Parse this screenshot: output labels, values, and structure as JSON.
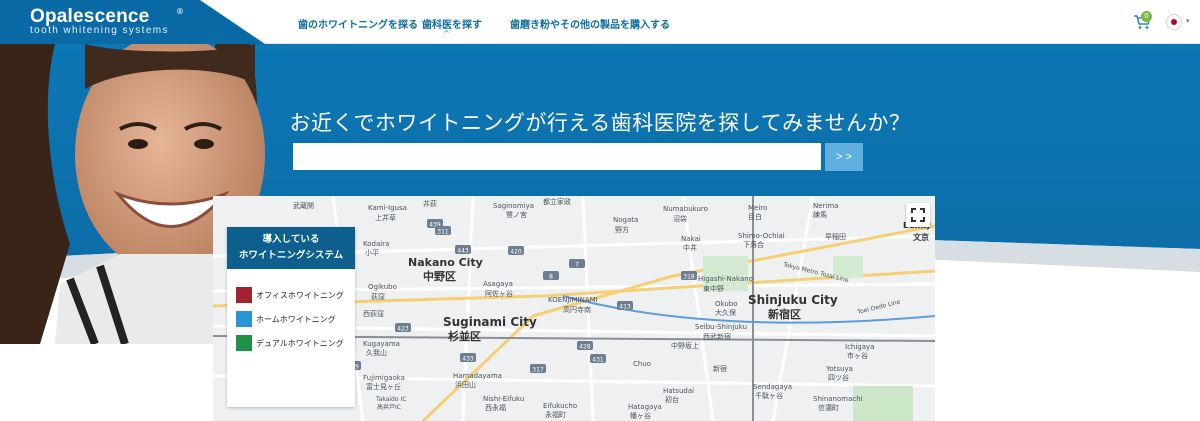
{
  "header": {
    "logo_text": "Opalescence",
    "logo_mark": "®",
    "logo_sub": "tooth whitening systems",
    "nav": [
      {
        "label": "歯のホワイトニングを探る"
      },
      {
        "label": "歯科医を探す",
        "caret": "^"
      },
      {
        "label": "歯磨き粉やその他の製品を購入する"
      }
    ],
    "cart_count": "0",
    "cart_icon": "cart-icon",
    "flag_icon": "japan-flag-icon",
    "flag_caret": "▾",
    "colors": {
      "brand": "#0a6aa6",
      "nav_text": "#0d6f9e"
    }
  },
  "hero": {
    "title": "お近くでホワイトニングが行える歯科医院を探してみませんか？",
    "search_placeholder": "",
    "search_button": "> >",
    "colors": {
      "banner": "#0b77b4",
      "button": "#5fb0de"
    }
  },
  "map": {
    "fullscreen_icon": "fullscreen-icon",
    "labels": {
      "nakano_en": "Nakano City",
      "nakano_jp": "中野区",
      "suginami_en": "Suginami City",
      "suginami_jp": "杉並区",
      "shinjuku_en": "Shinjuku City",
      "shinjuku_jp": "新宿区",
      "koenjiminami": "KOENJIMINAMI",
      "koenji_jp": "高円寺南",
      "asagaya": "Asagaya",
      "asagaya_jp": "阿佐ヶ谷",
      "ogikubo": "Ogikubo",
      "ogikubo_jp": "荻窪",
      "nogata": "Nogata",
      "nogata_jp": "野方",
      "numabukuro": "Numabukuro",
      "numabukuro_jp": "沼袋",
      "saginomiya": "Saginomiya",
      "saginomiya_jp": "鷺ノ宮",
      "kamiigusa": "Kami-Igusa",
      "kamiigusa_jp": "上井草",
      "musashiseki_jp": "武蔵関",
      "igusa_jp": "井荻",
      "toritsukasei_jp": "都立家政",
      "nakai": "Nakai",
      "nakai_jp": "中井",
      "shimoochiai": "Shimo-Ochiai",
      "shimoochiai_jp": "下落合",
      "higashinakano": "Higashi-Nakano",
      "higashinakano_jp": "東中野",
      "okubo": "Okubo",
      "okubo_jp": "大久保",
      "seibushinjuku": "Seibu-Shinjuku",
      "seibushinjuku_jp": "西武新宿",
      "meiro": "Meiro",
      "meiro_jp": "目白",
      "hamadayama": "Hamadayama",
      "hamadayama_jp": "浜田山",
      "eifukucho": "Eifukucho",
      "eifukucho_jp": "永福町",
      "nishieifuku": "Nishi-Eifuku",
      "nishieifuku_jp": "西永福",
      "fujimigaoka": "Fujimigaoka",
      "fujimigaoka_jp": "富士見ヶ丘",
      "kugayama": "Kugayama",
      "kugayama_jp": "久我山",
      "takaido": "Takaido IC",
      "takaido_jp": "高井戸IC",
      "hatsudai": "Hatsudai",
      "hatsudai_jp": "初台",
      "hatagaya": "Hatagaya",
      "hatagaya_jp": "幡ヶ谷",
      "yotsuya": "Yotsuya",
      "yotsuya_jp": "四ツ谷",
      "ichigaya": "Ichigaya",
      "ichigaya_jp": "市ヶ谷",
      "sendagaya": "Sendagaya",
      "sendagaya_jp": "千駄ヶ谷",
      "shinanomachi": "Shinanomachi",
      "shinanomachi_jp": "信濃町",
      "tokyometro": "Tokyo Metro Tozai Line",
      "toeioedo": "Toei Oedo Line",
      "bunkyo": "Bunky",
      "bunkyo_jp": "文京",
      "waseda_jp": "早稲田",
      "nakanosakaue_jp": "中野坂上",
      "shinjuku_jp2": "新宿",
      "kokubunji": "Kodaira",
      "kodaira_jp": "小平",
      "nishiogi_jp": "西荻窪",
      "bar_a": "Chuo",
      "toritsudaigaku": "Nerima",
      "nerima_jp": "練馬"
    },
    "route_numbers": [
      "439",
      "311",
      "443",
      "420",
      "7",
      "8",
      "318",
      "413",
      "428",
      "431",
      "317",
      "433",
      "423",
      "419"
    ]
  },
  "legend": {
    "heading_line1": "導入している",
    "heading_line2": "ホワイトニングシステム",
    "items": [
      {
        "label": "オフィスホワイトニング",
        "color": "#a32330"
      },
      {
        "label": "ホームホワイトニング",
        "color": "#2a95d6"
      },
      {
        "label": "デュアルホワイトニング",
        "color": "#1f9448"
      }
    ]
  }
}
